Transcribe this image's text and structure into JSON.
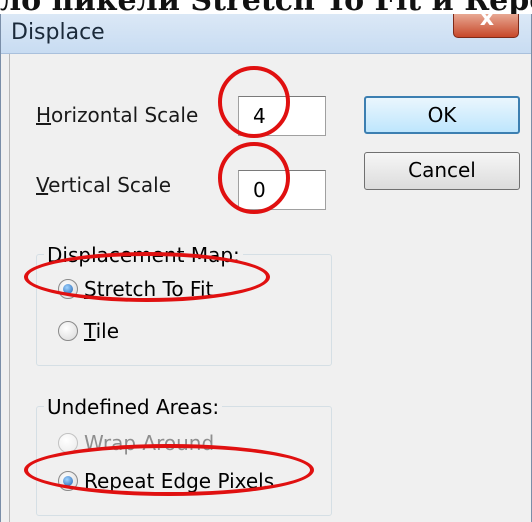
{
  "banner_text": "ло пикели Stretch To Fit и Repeat",
  "dialog": {
    "title": "Displace",
    "close_glyph": "x"
  },
  "horizontal_scale": {
    "label_prefix": "",
    "accel": "H",
    "label_rest": "orizontal Scale",
    "value": "4"
  },
  "vertical_scale": {
    "accel": "V",
    "label_rest": "ertical Scale",
    "value": "0"
  },
  "buttons": {
    "ok": "OK",
    "cancel": "Cancel"
  },
  "displacement_map": {
    "title": "Displacement Map:",
    "options": [
      {
        "accel": "S",
        "rest": "tretch To Fit",
        "checked": true
      },
      {
        "accel": "T",
        "rest": "ile",
        "checked": false
      }
    ]
  },
  "undefined_areas": {
    "title": "Undefined Areas:",
    "options": [
      {
        "accel": "",
        "rest": "Wrap Around",
        "checked": false,
        "disabled": true
      },
      {
        "accel": "R",
        "rest": "epeat Edge Pixels",
        "checked": true
      }
    ]
  },
  "highlight_color": "#e01010"
}
